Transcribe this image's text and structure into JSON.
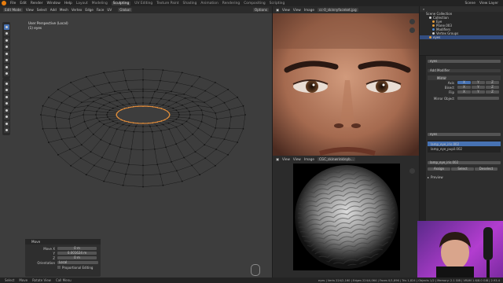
{
  "topbar": {
    "menus": [
      "File",
      "Edit",
      "Render",
      "Window",
      "Help"
    ],
    "tabs": [
      "Layout",
      "Modeling",
      "Sculpting",
      "UV Editing",
      "Texture Paint",
      "Shading",
      "Animation",
      "Rendering",
      "Compositing",
      "Scripting"
    ],
    "active_tab": "Sculpting",
    "scene": "Scene",
    "view_layer": "View Layer"
  },
  "viewport": {
    "mode": "Edit Mode",
    "menus": [
      "View",
      "Select",
      "Add",
      "Mesh",
      "Vertex",
      "Edge",
      "Face",
      "UV"
    ],
    "orientation": "Global",
    "options_label": "Options",
    "view_name": "User Perspective (Local)",
    "object_name": "(1) eyes"
  },
  "operator_panel": {
    "title": "Move",
    "move_x_label": "Move X",
    "move_x": "0 m",
    "y_label": "Y",
    "y": "0.001624 m",
    "z_label": "Z",
    "z": "0 m",
    "orientation_label": "Orientation",
    "orientation": "Local",
    "proportional_label": "Proportional Editing"
  },
  "image_editor_top": {
    "menus": [
      "View",
      "View",
      "Image"
    ],
    "image_name": "cc-0_skinnyfaceket.jpg"
  },
  "image_editor_bottom": {
    "menus": [
      "View",
      "View",
      "Image"
    ],
    "image_name": "CGC_skinwrinkleyb..."
  },
  "outliner": {
    "root": "Scene Collection",
    "items": [
      {
        "label": "Collection",
        "color": "#cfcfcf"
      },
      {
        "label": "Eye",
        "color": "#e39b3a"
      },
      {
        "label": "Plane.003",
        "color": "#e39b3a"
      },
      {
        "label": "Modifiers",
        "color": "#4d8ad6"
      },
      {
        "label": "Vertex Groups",
        "color": "#cfcfcf"
      },
      {
        "label": "eyes",
        "color": "#e39b3a"
      }
    ]
  },
  "properties": {
    "object_field": "eyes",
    "add_modifier": "Add Modifier",
    "modifier_name": "Mirror",
    "axis_label": "Axis",
    "bisect_label": "Bisect",
    "flip_label": "Flip",
    "axis_letters": [
      "X",
      "Y",
      "Z"
    ],
    "mirror_object": "Mirror Object",
    "vgroup_object": "eyes",
    "vgroup_items": [
      "lamp_eye_iris.002",
      "lamp_eye_pupil.002"
    ],
    "vgroup_selected": "lamp_eye_iris.002",
    "weight_field": "lamp_eye_iris.002",
    "assign_label": "Assign",
    "select_label": "Select",
    "deselect_label": "Deselect",
    "preview_label": "Preview"
  },
  "statusbar": {
    "left": [
      "Select",
      "Move",
      "Rotate View",
      "Call Menu"
    ],
    "right": "eyes | Verts 224/2,160 | Edges 224/4,064 | Faces 0/1,896 | Tris 1,824 | Objects 1/2 | Memory: 2.1 GiB | VRAM 1.6/8.0 GiB | 2.93.4"
  }
}
